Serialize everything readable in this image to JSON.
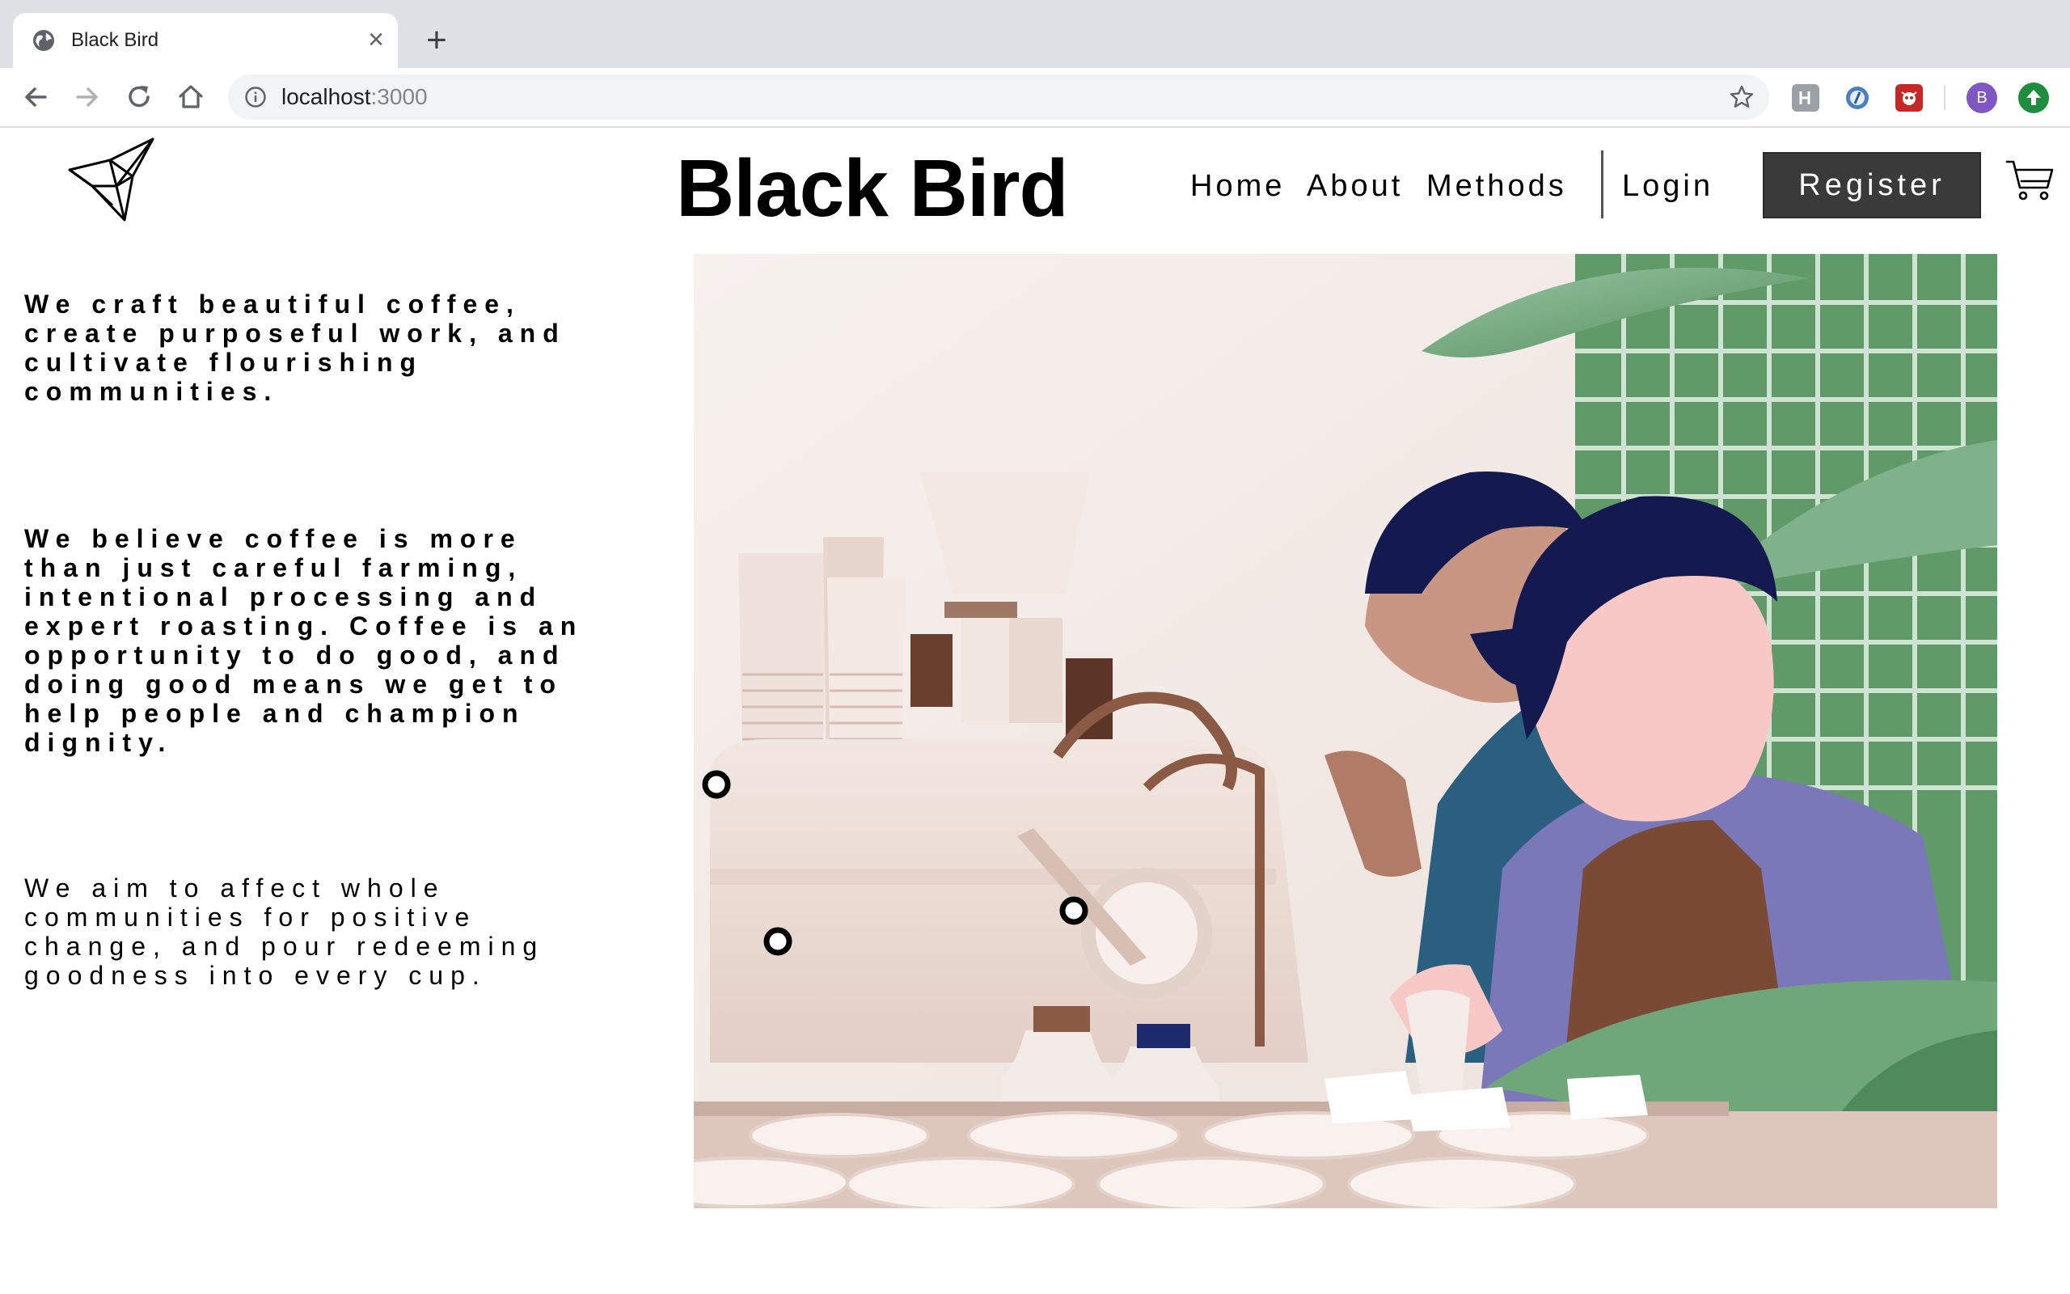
{
  "browser": {
    "tab_title": "Black Bird",
    "tab_close": "×",
    "new_tab": "+",
    "url_host": "localhost",
    "url_port": ":3000",
    "profile_initial": "B"
  },
  "site": {
    "title": "Black Bird",
    "nav": {
      "home": "Home",
      "about": "About",
      "methods": "Methods",
      "login": "Login",
      "register": "Register"
    }
  },
  "intro": {
    "p1": "We craft beautiful coffee, create purposeful work, and cultivate flourishing communities.",
    "p2": "We believe coffee is more than just careful farming, intentional processing and expert roasting. Coffee is an opportunity to do good, and doing good means we get to help people and champion dignity.",
    "p3": "We aim to affect whole communities for positive change, and pour redeeming goodness into every cup."
  },
  "colors": {
    "register_bg": "#3a3a3a",
    "hero_bg": "#f4ebe6",
    "tile_green": "#4f8a5a",
    "hair_navy": "#141a4f",
    "apron_brown": "#7a4a34",
    "shirt_purple": "#7a78b8",
    "profile_purple": "#7e57c2"
  },
  "icons": [
    "globe-icon",
    "close-icon",
    "plus-icon",
    "back-arrow-icon",
    "forward-arrow-icon",
    "reload-icon",
    "home-icon",
    "info-icon",
    "star-icon",
    "extension-icon",
    "profile-avatar",
    "update-icon",
    "origami-bird-logo",
    "cart-icon"
  ]
}
